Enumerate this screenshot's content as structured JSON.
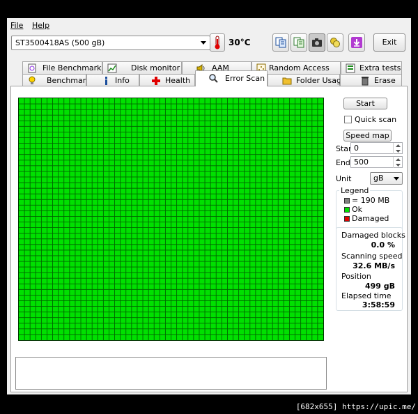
{
  "menu": {
    "file": "File",
    "help": "Help"
  },
  "toolbar": {
    "drive": "ST3500418AS (500 gB)",
    "temperature": "30",
    "temperature_unit": "°C",
    "exit": "Exit",
    "icons": [
      "copy-text-icon",
      "copy-info-icon",
      "camera-icon",
      "compare-icon",
      "save-down-icon"
    ]
  },
  "tabs_row1": [
    {
      "label": "File Benchmark",
      "icon": "file-benchmark-icon"
    },
    {
      "label": "Disk monitor",
      "icon": "disk-monitor-icon"
    },
    {
      "label": "AAM",
      "icon": "speaker-icon"
    },
    {
      "label": "Random Access",
      "icon": "random-access-icon"
    },
    {
      "label": "Extra tests",
      "icon": "extra-tests-icon"
    }
  ],
  "tabs_row2": [
    {
      "label": "Benchmark",
      "icon": "lightbulb-icon"
    },
    {
      "label": "Info",
      "icon": "info-icon"
    },
    {
      "label": "Health",
      "icon": "health-cross-icon"
    },
    {
      "label": "Error Scan",
      "icon": "magnifier-icon",
      "active": true
    },
    {
      "label": "Folder Usage",
      "icon": "folder-icon"
    },
    {
      "label": "Erase",
      "icon": "trash-icon"
    }
  ],
  "controls": {
    "start_button": "Start",
    "quick_scan": "Quick scan",
    "quick_scan_checked": false,
    "speed_map": "Speed map",
    "start_label": "Start",
    "start_value": "0",
    "end_label": "End",
    "end_value": "500",
    "unit_label": "Unit",
    "unit_value": "gB"
  },
  "legend": {
    "title": "Legend",
    "block": "= 190 MB",
    "ok": "Ok",
    "damaged": "Damaged",
    "colors": {
      "block": "#808080",
      "ok": "#00e000",
      "damaged": "#e00000"
    }
  },
  "stats": {
    "damaged_blocks_label": "Damaged blocks",
    "damaged_blocks_value": "0.0 %",
    "scanning_speed_label": "Scanning speed",
    "scanning_speed_value": "32.6 MB/s",
    "position_label": "Position",
    "position_value": "499 gB",
    "elapsed_label": "Elapsed time",
    "elapsed_value": "3:58:59"
  },
  "scan_grid": {
    "columns": 54,
    "rows": 43,
    "ok_color": "#00e000",
    "line_color": "#006400",
    "damaged_blocks": 0
  },
  "watermark": "[682x655] https://upic.me/"
}
